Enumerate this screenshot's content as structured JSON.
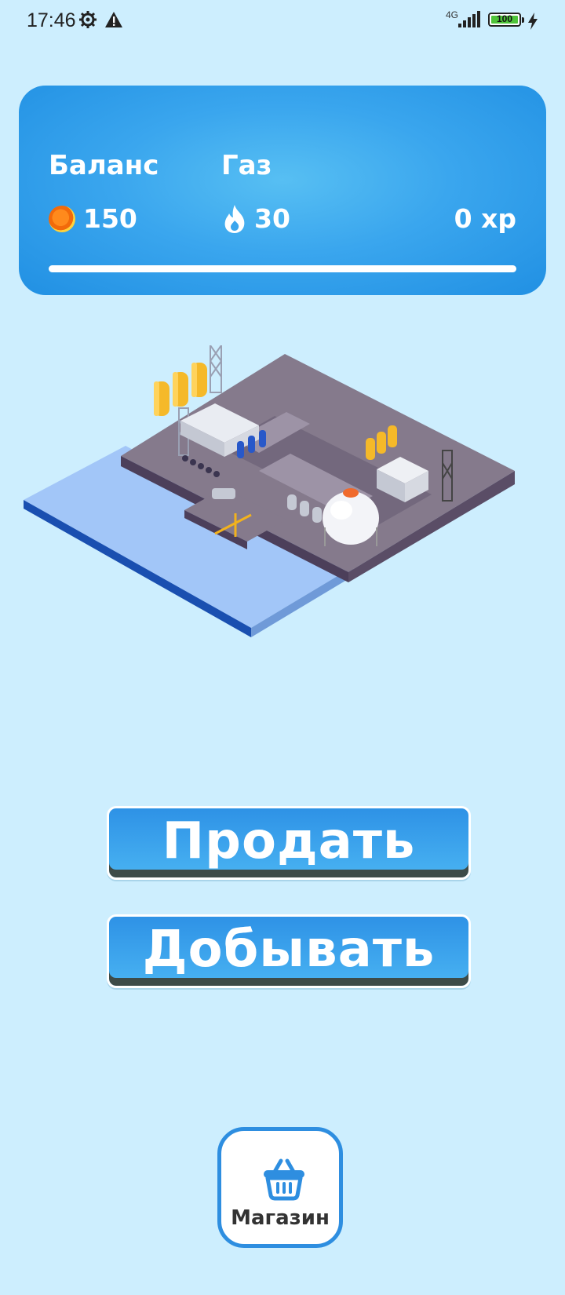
{
  "status_bar": {
    "time": "17:46",
    "network": "4G",
    "battery_level": "100",
    "battery_fraction": 1.0,
    "icons": [
      "gear-icon",
      "warning-icon",
      "signal-icon",
      "battery-icon",
      "charging-icon"
    ]
  },
  "stats": {
    "balance_label": "Баланс",
    "balance_value": "150",
    "gas_label": "Газ",
    "gas_value": "30",
    "xp_value": "0 xp",
    "xp_progress_fraction": 1.0,
    "icons": [
      "coin-icon",
      "flame-icon"
    ]
  },
  "buttons": {
    "sell_label": "Продать",
    "mine_label": "Добывать"
  },
  "shop": {
    "label": "Магазин",
    "icon": "basket-icon"
  },
  "colors": {
    "background": "#cdeefe",
    "panel_blue": "#2190e3",
    "button_blue": "#3aa6ee",
    "button_shadow": "#3d4b48",
    "shop_border": "#2e8ee0"
  }
}
